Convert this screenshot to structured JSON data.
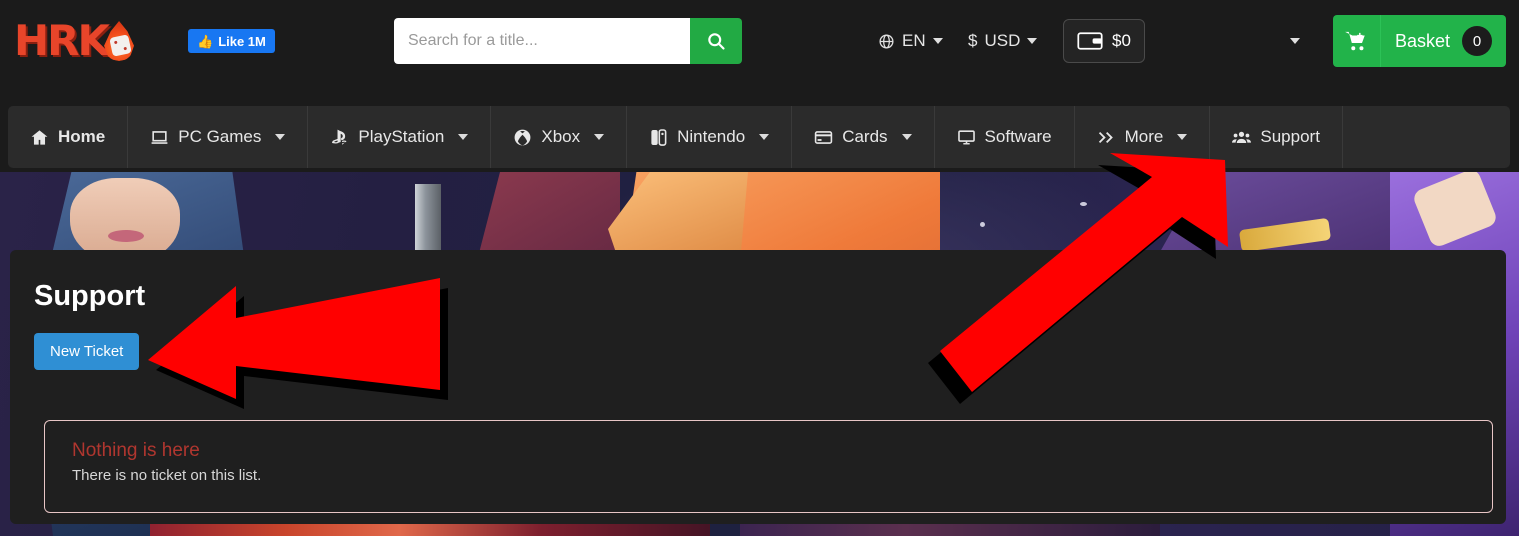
{
  "header": {
    "logo_text": "HRK",
    "logo_icon": "flame-dice-icon",
    "like_label": "Like 1M",
    "like_icon": "thumbs-up-icon",
    "search": {
      "placeholder": "Search for a title...",
      "value": "",
      "button_icon": "search-icon"
    },
    "language": {
      "label": "EN",
      "icon": "globe-icon"
    },
    "currency": {
      "label": "USD",
      "symbol": "$"
    },
    "wallet": {
      "label": "$0",
      "icon": "wallet-icon"
    },
    "account_caret_icon": "chevron-down-icon",
    "basket": {
      "label": "Basket",
      "count": "0",
      "icon": "shopping-cart-icon"
    }
  },
  "nav": {
    "items": [
      {
        "label": "Home",
        "icon": "home-icon",
        "caret": false,
        "active": true
      },
      {
        "label": "PC Games",
        "icon": "laptop-icon",
        "caret": true,
        "active": false
      },
      {
        "label": "PlayStation",
        "icon": "playstation-icon",
        "caret": true,
        "active": false
      },
      {
        "label": "Xbox",
        "icon": "xbox-icon",
        "caret": true,
        "active": false
      },
      {
        "label": "Nintendo",
        "icon": "nintendo-switch-icon",
        "caret": true,
        "active": false
      },
      {
        "label": "Cards",
        "icon": "credit-card-icon",
        "caret": true,
        "active": false
      },
      {
        "label": "Software",
        "icon": "desktop-icon",
        "caret": false,
        "active": false
      },
      {
        "label": "More",
        "icon": "double-chevron-right-icon",
        "caret": true,
        "active": false
      },
      {
        "label": "Support",
        "icon": "users-icon",
        "caret": false,
        "active": false
      }
    ]
  },
  "main": {
    "title": "Support",
    "new_ticket_label": "New Ticket",
    "alert": {
      "title": "Nothing is here",
      "text": "There is no ticket on this list."
    }
  },
  "annotations": {
    "arrow_color": "#FF0000",
    "shadow_color": "#000000",
    "arrows": [
      {
        "name": "arrow-pointing-to-support-nav",
        "direction": "up-right"
      },
      {
        "name": "arrow-pointing-to-new-ticket-button",
        "direction": "left"
      }
    ]
  },
  "colors": {
    "page_background": "#1b1b1b",
    "nav_background": "#2b2b2b",
    "content_background": "#1f1f1f",
    "accent_green": "#22b34a",
    "accent_blue": "#2f8fd4",
    "facebook_blue": "#1877f2",
    "logo_red": "#e8452a",
    "alert_title": "#b0362f",
    "alert_border": "#e8c6c6"
  }
}
